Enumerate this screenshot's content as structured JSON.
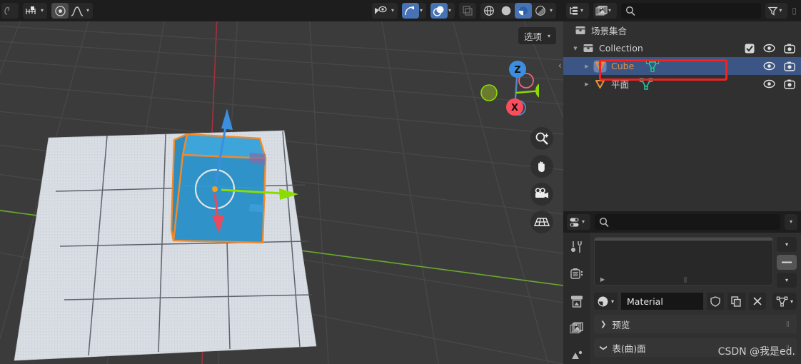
{
  "app": {
    "name": "Blender",
    "theme_bg": "#303030",
    "accent_blue": "#4772b3",
    "select_orange": "#e8923c"
  },
  "viewport": {
    "options_label": "选项",
    "header_groups": [
      {
        "name": "editor-type",
        "icons": [
          "editor-type-icon"
        ]
      },
      {
        "name": "interaction-mode",
        "icons": [
          "magnet-icon",
          "snap-icon",
          "chevron-down-icon"
        ]
      },
      {
        "name": "proportional-edit",
        "icons": [
          "proportional-editing-icon",
          "falloff-curve-icon",
          "chevron-down-icon"
        ]
      },
      {
        "name": "visibility",
        "icons": [
          "show-gizmo-icon",
          "chevron-down-icon"
        ]
      },
      {
        "name": "gizmos",
        "icons": [
          "gizmo-icon",
          "chevron-down-icon"
        ]
      },
      {
        "name": "overlays",
        "icons": [
          "overlays-icon",
          "chevron-down-icon"
        ]
      },
      {
        "name": "xray",
        "icons": [
          "xray-icon"
        ]
      },
      {
        "name": "shading",
        "icons": [
          "wireframe-icon",
          "solid-icon",
          "material-preview-icon",
          "rendered-icon",
          "chevron-down-icon"
        ]
      }
    ],
    "side_tools": [
      "zoom-icon",
      "hand-icon",
      "camera-icon",
      "grid-icon"
    ],
    "gizmo": {
      "axes": [
        "Z",
        "Y",
        "X"
      ],
      "colors": {
        "x": "#fc4d5d",
        "y": "#8bdc00",
        "z": "#3c8ee0"
      }
    },
    "object": {
      "name": "Cube",
      "color": "#2f93c9",
      "outline": "#f18a2c"
    }
  },
  "outliner": {
    "header": {
      "editor_type_icon": "outliner-icon",
      "display_mode_icon": "view-layer-icon",
      "search_placeholder": "",
      "filter_icon": "filter-icon"
    },
    "rows": [
      {
        "name": "场景集合",
        "icon": "collection-icon",
        "indent": 0,
        "selected": false,
        "expandable": false,
        "checkbox": false,
        "eye": false,
        "camera": false
      },
      {
        "name": "Collection",
        "icon": "collection-icon",
        "indent": 1,
        "selected": false,
        "expandable": true,
        "checkbox": true,
        "eye": true,
        "camera": true
      },
      {
        "name": "Cube",
        "icon": "mesh-object-icon",
        "indent": 2,
        "selected": true,
        "expandable": true,
        "checkbox": false,
        "eye": true,
        "camera": true,
        "data_icon": "mesh-data-icon"
      },
      {
        "name": "平面",
        "icon": "mesh-object-icon",
        "indent": 2,
        "selected": false,
        "expandable": true,
        "checkbox": false,
        "eye": true,
        "camera": true,
        "data_icon": "mesh-data-icon"
      }
    ],
    "annotation": {
      "type": "red-highlight-box",
      "target": "Cube",
      "color": "#f42121"
    }
  },
  "properties": {
    "header": {
      "editor_type_icon": "properties-icon",
      "search_placeholder": "",
      "options_icon": "chevron-down-icon"
    },
    "tabs": [
      {
        "name": "tool",
        "icon": "tool-icon"
      },
      {
        "name": "render",
        "icon": "render-icon"
      },
      {
        "name": "output",
        "icon": "output-icon"
      },
      {
        "name": "view-layer",
        "icon": "view-layer-icon"
      },
      {
        "name": "scene",
        "icon": "scene-icon"
      }
    ],
    "slot_buttons": [
      "chevron-down-icon",
      "remove-slot-icon",
      "chevron-down-icon"
    ],
    "material": {
      "browse_icon": "material-browse-icon",
      "name": "Material",
      "shield_icon": "fake-user-icon",
      "copy_icon": "new-material-icon",
      "unlink_icon": "unlink-icon",
      "data_icon": "mesh-data-icon"
    },
    "panels": [
      {
        "label": "预览",
        "expanded": false
      },
      {
        "label": "表(曲)面",
        "expanded": true
      }
    ]
  },
  "watermark": {
    "text": "CSDN @我是ed."
  }
}
